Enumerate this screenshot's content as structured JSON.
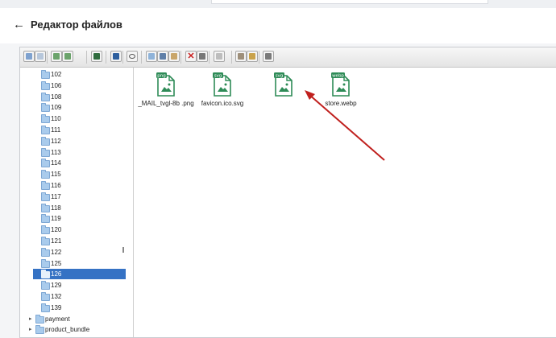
{
  "header": {
    "back_icon": "arrow-left-icon",
    "title": "Редактор файлов"
  },
  "toolbar": {
    "buttons": [
      {
        "name": "back-nav-button",
        "icon": "arrow-left-icon",
        "color": "#7fa2cf"
      },
      {
        "name": "forward-nav-button",
        "icon": "arrow-right-icon",
        "color": "#b7c7db"
      },
      {
        "name": "upload-button",
        "icon": "upload-icon",
        "color": "#6ba36b"
      },
      {
        "name": "download-button",
        "icon": "download-icon",
        "color": "#6ba36b"
      },
      {
        "name": "save-button",
        "icon": "floppy-icon",
        "color": "#2f6b3e"
      },
      {
        "name": "info-button",
        "icon": "info-icon",
        "color": "#2e5f9e"
      },
      {
        "name": "preview-button",
        "icon": "eye-icon",
        "color": "#555555"
      },
      {
        "name": "copy-button",
        "icon": "copy-icon",
        "color": "#8fb3d9"
      },
      {
        "name": "cut-button",
        "icon": "scissors-icon",
        "color": "#5f7fa8"
      },
      {
        "name": "paste-button",
        "icon": "paste-icon",
        "color": "#c9a66b"
      },
      {
        "name": "delete-button",
        "icon": "delete-icon",
        "color": "#c81e1e"
      },
      {
        "name": "rename-button",
        "icon": "rename-icon",
        "color": "#777777"
      },
      {
        "name": "edit-button",
        "icon": "edit-icon",
        "color": "#bdbdbd"
      },
      {
        "name": "extract-button",
        "icon": "archive-icon",
        "color": "#9e8f7a"
      },
      {
        "name": "resize-button",
        "icon": "resize-icon",
        "color": "#c9a24b"
      },
      {
        "name": "view-mode-button",
        "icon": "list-view-icon",
        "color": "#7a7a7a"
      }
    ]
  },
  "tree": {
    "items": [
      {
        "label": "102"
      },
      {
        "label": "106"
      },
      {
        "label": "108"
      },
      {
        "label": "109"
      },
      {
        "label": "110"
      },
      {
        "label": "111"
      },
      {
        "label": "112"
      },
      {
        "label": "113"
      },
      {
        "label": "114"
      },
      {
        "label": "115"
      },
      {
        "label": "116"
      },
      {
        "label": "117"
      },
      {
        "label": "118"
      },
      {
        "label": "119"
      },
      {
        "label": "120"
      },
      {
        "label": "121"
      },
      {
        "label": "122"
      },
      {
        "label": "125"
      },
      {
        "label": "126",
        "selected": true
      },
      {
        "label": "129"
      },
      {
        "label": "132"
      },
      {
        "label": "139"
      }
    ],
    "roots": [
      {
        "label": "payment"
      },
      {
        "label": "product_bundle"
      }
    ]
  },
  "files": [
    {
      "badge": "png",
      "name": "_MAIL_tvgl-8b .png",
      "badge_color": "#2e8b57"
    },
    {
      "badge": "svg",
      "name": "favicon.ico.svg",
      "badge_color": "#2e8b57"
    },
    {
      "badge": "svg",
      "name": "",
      "badge_color": "#2e8b57"
    },
    {
      "badge": "webp",
      "name": "store.webp",
      "badge_color": "#2e8b57"
    }
  ],
  "colors": {
    "selection": "#3572c4",
    "folder": "#a9cbec",
    "annotation_arrow": "#c0201e"
  }
}
